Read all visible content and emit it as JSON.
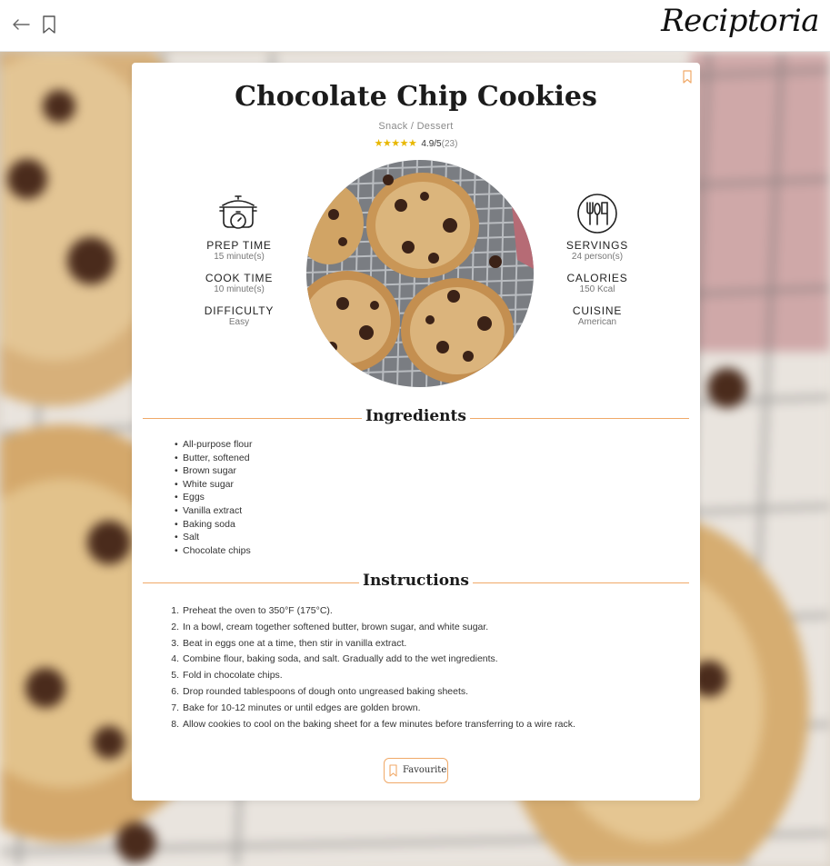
{
  "app": {
    "brand": "Reciptoria"
  },
  "recipe": {
    "title": "Chocolate Chip Cookies",
    "category": "Snack / Dessert",
    "rating": {
      "stars": "★★★★★",
      "score": "4.9/5",
      "count": "(23)"
    },
    "stats": {
      "prep_time": {
        "label": "PREP TIME",
        "value": "15 minute(s)"
      },
      "cook_time": {
        "label": "COOK TIME",
        "value": "10 minute(s)"
      },
      "difficulty": {
        "label": "DIFFICULTY",
        "value": "Easy"
      },
      "servings": {
        "label": "SERVINGS",
        "value": "24 person(s)"
      },
      "calories": {
        "label": "CALORIES",
        "value": "150 Kcal"
      },
      "cuisine": {
        "label": "CUISINE",
        "value": "American"
      }
    },
    "ingredients_heading": "Ingredients",
    "ingredients": [
      "All-purpose flour",
      "Butter, softened",
      "Brown sugar",
      "White sugar",
      "Eggs",
      "Vanilla extract",
      "Baking soda",
      "Salt",
      "Chocolate chips"
    ],
    "instructions_heading": "Instructions",
    "instructions": [
      {
        "n": "1.",
        "text": "Preheat the oven to 350°F (175°C)."
      },
      {
        "n": "2.",
        "text": "In a bowl, cream together softened butter, brown sugar, and white sugar."
      },
      {
        "n": "3.",
        "text": "Beat in eggs one at a time, then stir in vanilla extract."
      },
      {
        "n": "4.",
        "text": "Combine flour, baking soda, and salt. Gradually add to the wet ingredients."
      },
      {
        "n": "5.",
        "text": "Fold in chocolate chips."
      },
      {
        "n": "6.",
        "text": "Drop rounded tablespoons of dough onto ungreased baking sheets."
      },
      {
        "n": "7.",
        "text": "Bake for 10-12 minutes or until edges are golden brown."
      },
      {
        "n": "8.",
        "text": "Allow cookies to cool on the baking sheet for a few minutes before transferring to a wire rack."
      }
    ],
    "favourite_label": "Favourite"
  },
  "icons": {
    "back": "arrow-left-icon",
    "bookmark": "bookmark-icon",
    "pot": "cooking-pot-timer-icon",
    "cutlery": "plate-cutlery-icon"
  },
  "colors": {
    "accent": "#f0a968",
    "star": "#e8b700",
    "text": "#222222"
  }
}
